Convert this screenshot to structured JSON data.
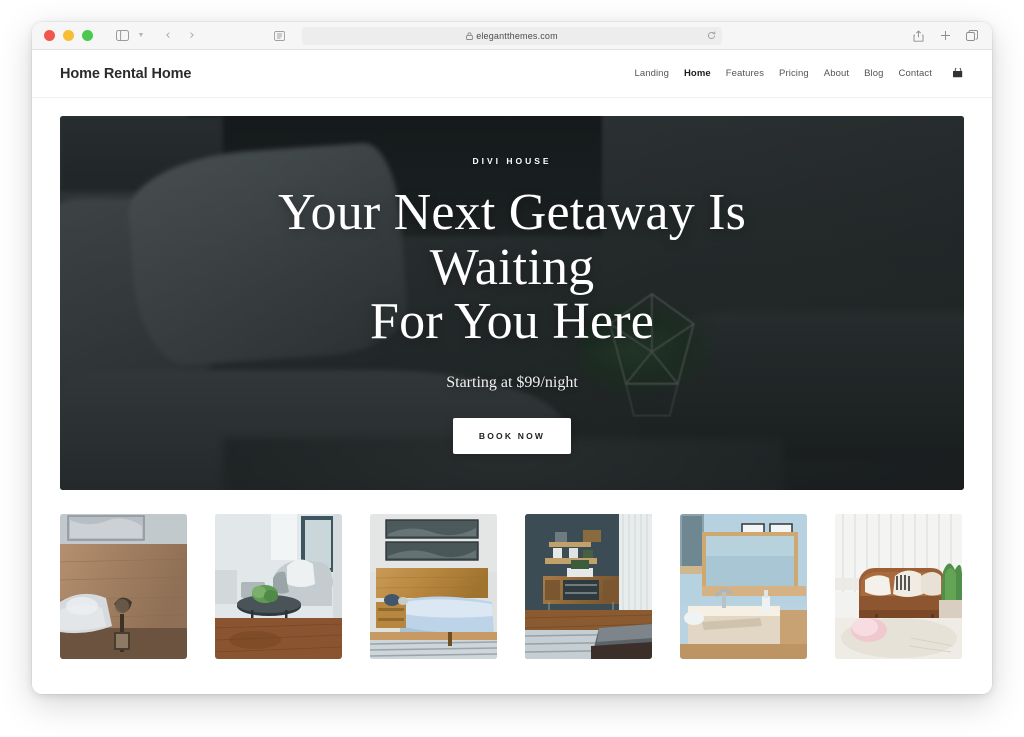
{
  "browser": {
    "address": "elegantthemes.com",
    "lock_icon": "lock-icon",
    "reload_icon": "reload-icon",
    "sidebar_icon": "sidebar-toggle-icon",
    "back_icon": "back-arrow-icon",
    "forward_icon": "forward-arrow-icon",
    "share_icon": "share-icon",
    "new_tab_icon": "plus-icon",
    "tabs_icon": "tab-overview-icon",
    "traffic_lights": [
      "close-button",
      "minimize-button",
      "maximize-button"
    ]
  },
  "site": {
    "logo": "Home Rental Home",
    "nav": [
      {
        "label": "Landing",
        "active": false
      },
      {
        "label": "Home",
        "active": true
      },
      {
        "label": "Features",
        "active": false
      },
      {
        "label": "Pricing",
        "active": false
      },
      {
        "label": "About",
        "active": false
      },
      {
        "label": "Blog",
        "active": false
      },
      {
        "label": "Contact",
        "active": false
      }
    ],
    "cart_icon": "shopping-cart-icon"
  },
  "hero": {
    "eyebrow": "DIVI HOUSE",
    "title_line1": "Your Next Getaway Is Waiting",
    "title_line2": "For You Here",
    "subtitle": "Starting at $99/night",
    "cta_label": "BOOK NOW",
    "overlay_color": "#16191a",
    "cta_bg": "#ffffff",
    "cta_text_color": "#1f1f1f"
  },
  "gallery": {
    "items": [
      {
        "alt": "Bedroom with wood headboard and bedside lamp"
      },
      {
        "alt": "Living room with armchair and round coffee table"
      },
      {
        "alt": "Wooden platform bed with blue bedding"
      },
      {
        "alt": "Bedroom with dark wall, credenza and shelves"
      },
      {
        "alt": "Bathroom with stone sink and framed prints"
      },
      {
        "alt": "Brown leather sofa with white pillows and plant"
      }
    ]
  },
  "theme": {
    "page_bg": "#ffffff",
    "toolbar_bg": "#f6f6f6",
    "header_border": "#efefef",
    "text_primary": "#2b2b2b",
    "text_muted": "#555555"
  }
}
